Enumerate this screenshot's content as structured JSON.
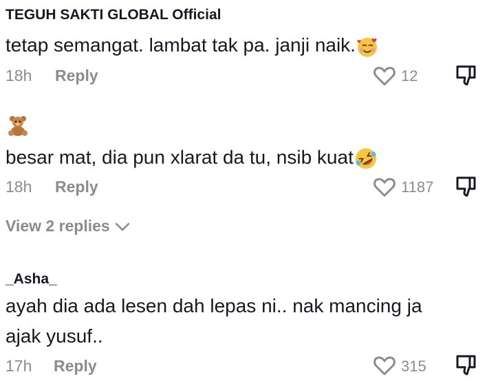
{
  "comments": [
    {
      "username": "TEGUH SAKTI GLOBAL Official",
      "text": "tetap semangat. lambat tak pa. janji naik.",
      "emoji": "smiling-face-with-hearts",
      "time": "18h",
      "reply_label": "Reply",
      "likes": "12"
    },
    {
      "avatar_emoji": "teddy-bear",
      "text": "besar mat, dia pun xlarat da tu, nsib kuat",
      "emoji": "rolling-on-floor-laughing",
      "time": "18h",
      "reply_label": "Reply",
      "likes": "1187",
      "view_replies_label": "View 2 replies"
    },
    {
      "username": "_Asha_",
      "text_line1": "ayah dia ada lesen dah lepas ni.. nak mancing ja",
      "text_line2": "ajak yusuf..",
      "time": "17h",
      "reply_label": "Reply",
      "likes": "315"
    }
  ],
  "colors": {
    "text": "#161823",
    "muted": "#8a8b91"
  }
}
